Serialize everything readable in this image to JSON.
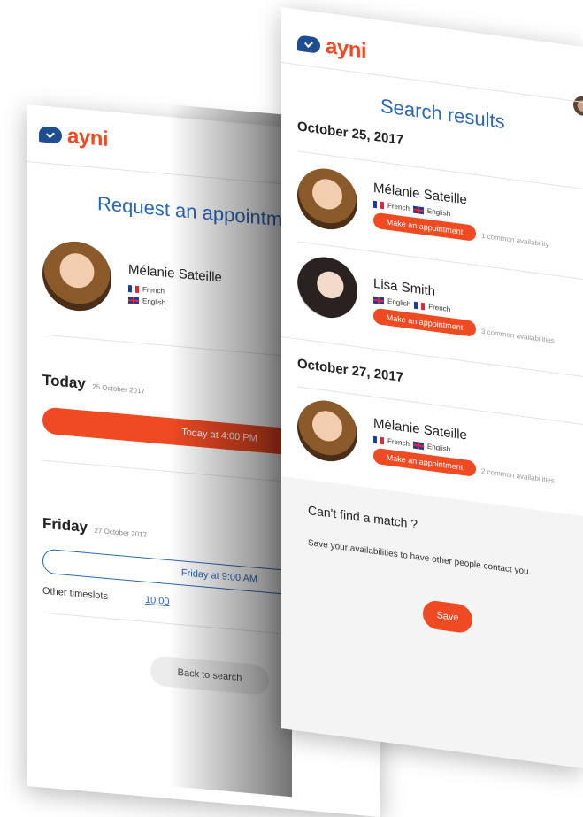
{
  "back_screen": {
    "logo": "ayni",
    "title": "Request an appointment",
    "profile": {
      "name": "Mélanie Sateille",
      "languages": [
        "French",
        "English"
      ]
    },
    "sections": [
      {
        "day": "Today",
        "date": "25 October 2017",
        "slot": "Today at 4:00 PM"
      },
      {
        "day": "Friday",
        "date": "27 October 2017",
        "slot": "Friday at 9:00 AM"
      }
    ],
    "other_timeslots_label": "Other timeslots",
    "other_timeslot_value": "10:00",
    "back_button": "Back to search"
  },
  "front_screen": {
    "logo": "ayni",
    "title": "Search results",
    "groups": [
      {
        "date": "October 25, 2017",
        "results": [
          {
            "name": "Mélanie Sateille",
            "languages": [
              "French",
              "English"
            ],
            "button": "Make an appointment",
            "availability": "1 common availability"
          },
          {
            "name": "Lisa Smith",
            "languages": [
              "English",
              "French"
            ],
            "button": "Make an appointment",
            "availability": "3 common availabilities"
          }
        ]
      },
      {
        "date": "October 27, 2017",
        "results": [
          {
            "name": "Mélanie Sateille",
            "languages": [
              "French",
              "English"
            ],
            "button": "Make an appointment",
            "availability": "2 common availabilities"
          }
        ]
      }
    ],
    "no_match": {
      "heading": "Can't find a match ?",
      "text": "Save your availabilities to have other people contact you.",
      "button": "Save"
    }
  },
  "colors": {
    "brand_orange": "#f04a23",
    "brand_blue": "#1e4d91",
    "title_blue": "#2a66b8"
  }
}
